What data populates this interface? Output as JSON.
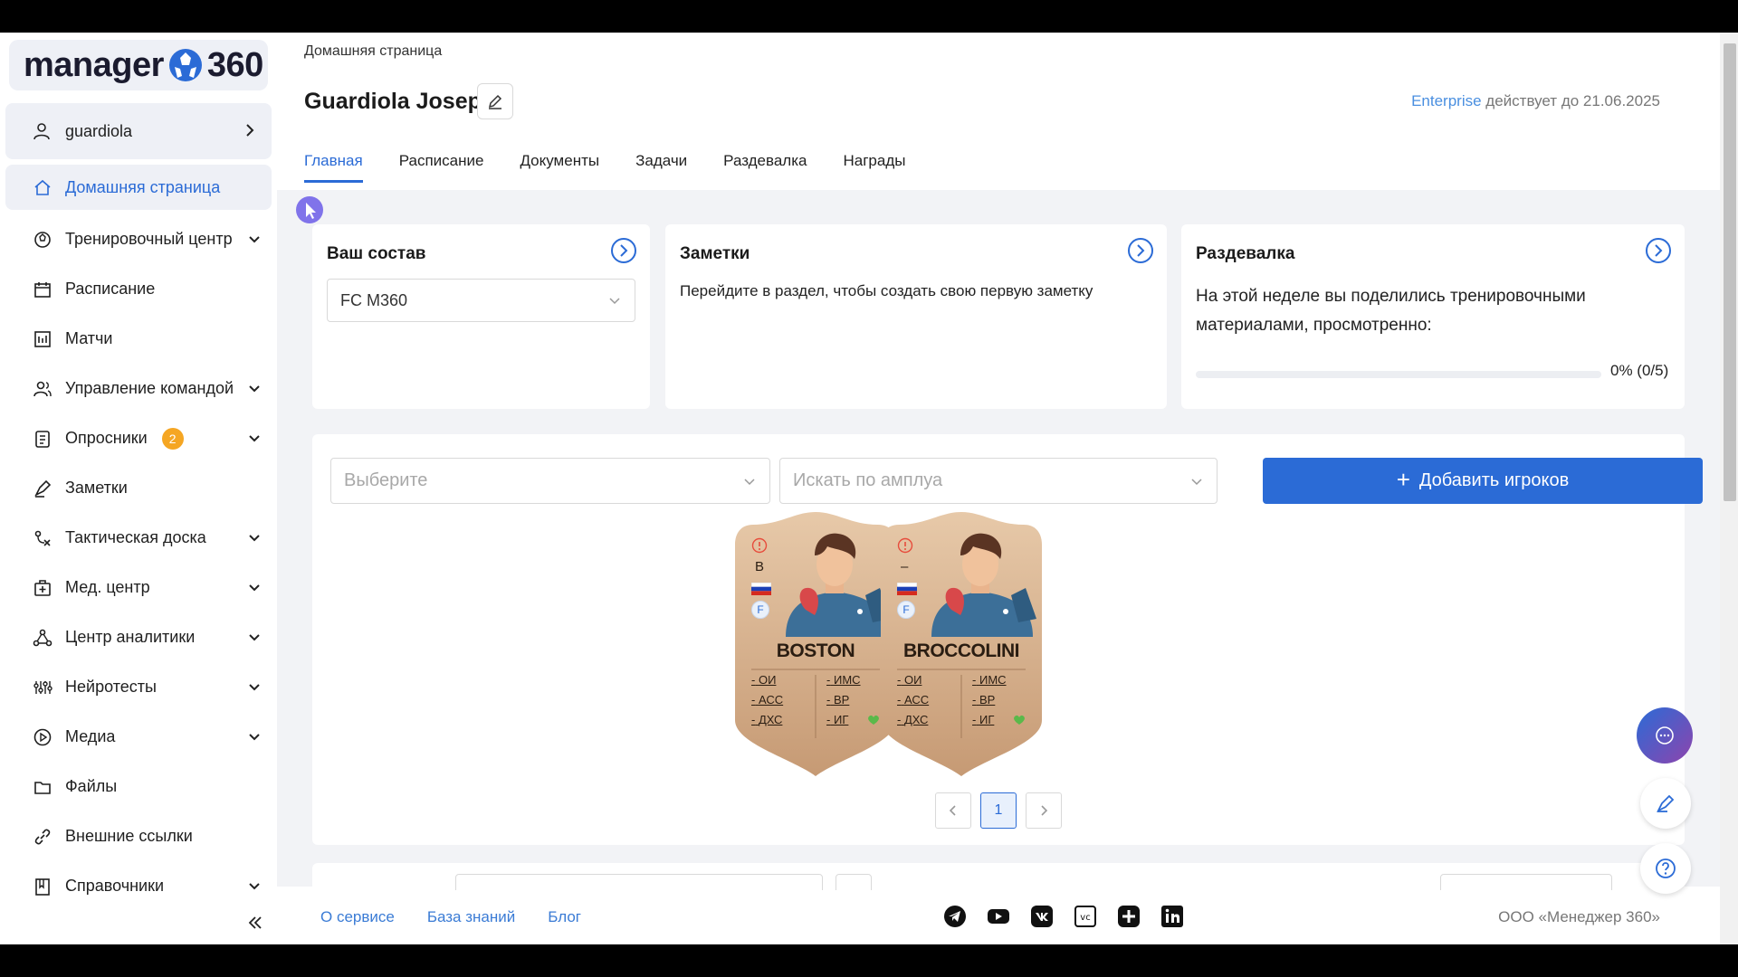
{
  "app": {
    "logo_text_left": "manager",
    "logo_text_right": "360",
    "brand_color": "#2b6bd6"
  },
  "sidebar": {
    "user": "guardiola",
    "items": [
      {
        "label": "Домашняя страница",
        "icon": "home-icon",
        "active": true,
        "has_children": false
      },
      {
        "label": "Тренировочный центр",
        "icon": "ball-icon",
        "active": false,
        "has_children": true
      },
      {
        "label": "Расписание",
        "icon": "calendar-icon",
        "active": false,
        "has_children": false
      },
      {
        "label": "Матчи",
        "icon": "match-icon",
        "active": false,
        "has_children": false
      },
      {
        "label": "Управление командой",
        "icon": "team-icon",
        "active": false,
        "has_children": true
      },
      {
        "label": "Опросники",
        "icon": "survey-icon",
        "active": false,
        "has_children": true,
        "badge": "2"
      },
      {
        "label": "Заметки",
        "icon": "pen-icon",
        "active": false,
        "has_children": false
      },
      {
        "label": "Тактическая доска",
        "icon": "tactics-icon",
        "active": false,
        "has_children": true
      },
      {
        "label": "Мед. центр",
        "icon": "medical-icon",
        "active": false,
        "has_children": true
      },
      {
        "label": "Центр аналитики",
        "icon": "analytics-icon",
        "active": false,
        "has_children": true
      },
      {
        "label": "Нейротесты",
        "icon": "neuro-icon",
        "active": false,
        "has_children": true
      },
      {
        "label": "Медиа",
        "icon": "play-icon",
        "active": false,
        "has_children": true
      },
      {
        "label": "Файлы",
        "icon": "folder-icon",
        "active": false,
        "has_children": false
      },
      {
        "label": "Внешние ссылки",
        "icon": "link-icon",
        "active": false,
        "has_children": false
      },
      {
        "label": "Справочники",
        "icon": "book-icon",
        "active": false,
        "has_children": true
      }
    ]
  },
  "header": {
    "breadcrumb": "Домашняя страница",
    "title": "Guardiola Josep",
    "plan_name": "Enterprise",
    "plan_suffix": "действует до 21.06.2025"
  },
  "tabs": [
    "Главная",
    "Расписание",
    "Документы",
    "Задачи",
    "Раздевалка",
    "Награды"
  ],
  "cards": {
    "squad": {
      "title": "Ваш состав",
      "selected_team": "FC M360"
    },
    "notes": {
      "title": "Заметки",
      "text": "Перейдите в раздел, чтобы создать свою первую заметку"
    },
    "locker": {
      "title": "Раздевалка",
      "text": "На этой неделе вы поделились тренировочными материалами, просмотренно:",
      "progress_percent": 0,
      "progress_label": "0% (0/5)"
    }
  },
  "players_panel": {
    "filter_placeholder": "Выберите",
    "role_placeholder": "Искать по амплуа",
    "add_button": "Добавить игроков",
    "players": [
      {
        "name": "BOSTON",
        "position": "B",
        "foot": "F",
        "stats_left": [
          "ОИ",
          "АСС",
          "ДХС"
        ],
        "stats_right": [
          "ИМС",
          "ВР",
          "ИГ"
        ]
      },
      {
        "name": "BROCCOLINI",
        "position": "–",
        "foot": "F",
        "stats_left": [
          "ОИ",
          "АСС",
          "ДХС"
        ],
        "stats_right": [
          "ИМС",
          "ВР",
          "ИГ"
        ]
      }
    ],
    "stat_dash": "-",
    "page": "1"
  },
  "footer": {
    "links": [
      "О сервисе",
      "База знаний",
      "Блог"
    ],
    "socials": [
      "telegram-icon",
      "youtube-icon",
      "vk-icon",
      "vc-icon",
      "plus-icon",
      "linkedin-icon"
    ],
    "company": "ООО «Менеджер 360»"
  }
}
